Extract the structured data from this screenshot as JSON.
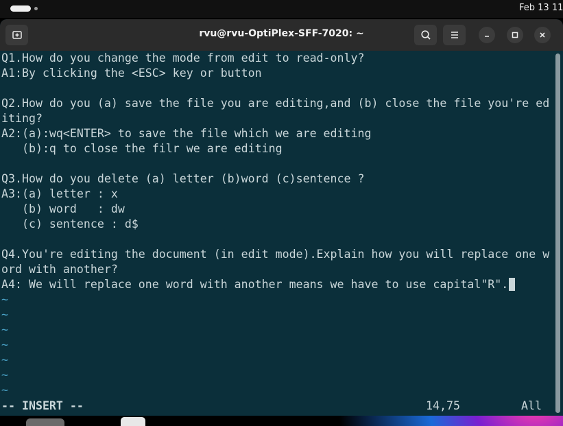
{
  "system": {
    "clock": "Feb 13  11"
  },
  "window": {
    "title": "rvu@rvu-OptiPlex-SFF-7020: ~"
  },
  "icons": {
    "new_tab": "new-tab-icon",
    "search": "search-icon",
    "menu": "hamburger-menu-icon",
    "minimize": "minimize-icon",
    "maximize": "maximize-icon",
    "close": "close-icon"
  },
  "terminal": {
    "lines": [
      "Q1.How do you change the mode from edit to read-only?",
      "A1:By clicking the <ESC> key or button",
      "",
      "Q2.How do you (a) save the file you are editing,and (b) close the file you're ed",
      "iting?",
      "A2:(a):wq<ENTER> to save the file which we are editing",
      "   (b):q to close the filr we are editing",
      "",
      "Q3.How do you delete (a) letter (b)word (c)sentence ?",
      "A3:(a) letter : x",
      "   (b) word   : dw",
      "   (c) sentence : d$",
      "",
      "Q4.You're editing the document (in edit mode).Explain how you will replace one w",
      "ord with another?",
      "A4: We will replace one word with another means we have to use capital\"R\"."
    ],
    "tildes": [
      "~",
      "~",
      "~",
      "~",
      "~",
      "~",
      "~"
    ],
    "status_mode": "-- INSERT --",
    "status_position": "14,75",
    "status_scroll": "All"
  }
}
